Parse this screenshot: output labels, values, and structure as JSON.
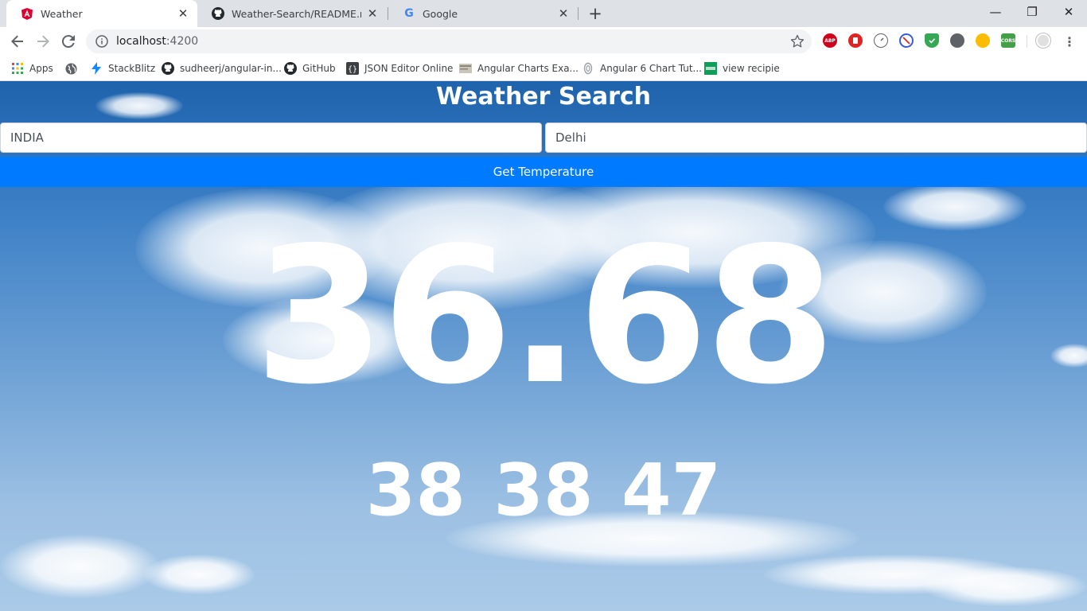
{
  "browser": {
    "tabs": [
      {
        "title": "Weather",
        "icon": "angular-icon",
        "active": true
      },
      {
        "title": "Weather-Search/README.md at",
        "icon": "github-icon",
        "active": false
      },
      {
        "title": "Google",
        "icon": "google-icon",
        "active": false
      }
    ],
    "new_tab": "+",
    "window_controls": {
      "minimize": "—",
      "restore": "❐",
      "close": "✕"
    },
    "address": {
      "host": "localhost",
      "port": ":4200"
    },
    "bookmarks": [
      {
        "label": "Apps",
        "icon": "apps-grid-icon"
      },
      {
        "label": "",
        "icon": "globe-icon"
      },
      {
        "label": "StackBlitz",
        "icon": "stackblitz-icon"
      },
      {
        "label": "sudheerj/angular-in...",
        "icon": "github-icon"
      },
      {
        "label": "GitHub",
        "icon": "github-icon"
      },
      {
        "label": "JSON Editor Online",
        "icon": "json-editor-icon"
      },
      {
        "label": "Angular Charts Exa...",
        "icon": "page-icon"
      },
      {
        "label": "Angular 6 Chart Tut...",
        "icon": "link-icon"
      },
      {
        "label": "view recipie",
        "icon": "green-app-icon"
      }
    ],
    "extensions": [
      {
        "name": "abp-icon",
        "text": "ABP",
        "color": "#d0021b"
      },
      {
        "name": "stop-icon",
        "text": "",
        "color": "#e02424"
      },
      {
        "name": "speedometer-icon",
        "text": "",
        "color": "#5f6368"
      },
      {
        "name": "block-icon",
        "text": "",
        "color": "#3b5bdb"
      },
      {
        "name": "shield-icon",
        "text": "",
        "color": "#34a853"
      },
      {
        "name": "bulb-dark-icon",
        "text": "",
        "color": "#5f6368"
      },
      {
        "name": "bulb-yellow-icon",
        "text": "",
        "color": "#fbbc04"
      },
      {
        "name": "cors-icon",
        "text": "CORS",
        "color": "#43a047"
      },
      {
        "name": "profile-icon",
        "text": "",
        "color": "#bdbdbd"
      }
    ]
  },
  "app": {
    "title": "Weather Search",
    "country": "INDIA",
    "city": "Delhi",
    "button_label": "Get Temperature",
    "temperature": "36.68",
    "min_max": "38 38 47"
  },
  "colors": {
    "primary_button": "#007bff",
    "sky_top": "#1f63ad",
    "sky_bottom": "#aacae8"
  }
}
